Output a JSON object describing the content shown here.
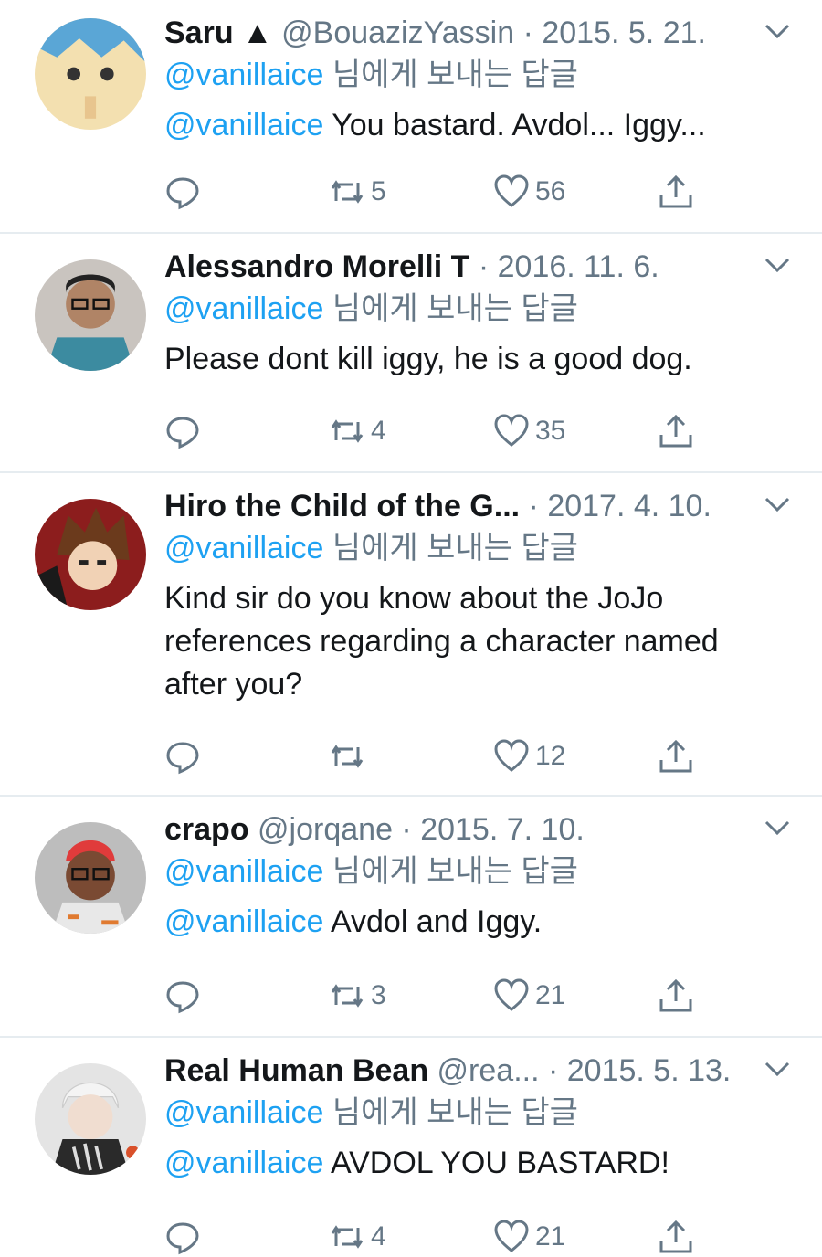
{
  "colors": {
    "accent": "#1da1f2",
    "secondary": "#657786",
    "divider": "#e6ecf0"
  },
  "tweets": [
    {
      "name": "Saru ▲",
      "handle": "@BouazizYassin",
      "date": "2015. 5. 21.",
      "reply_mention": "@vanillaice",
      "reply_suffix": " 님에게 보내는 답글",
      "text_mention": "@vanillaice",
      "text": " You bastard. Avdol... Iggy...",
      "retweets": "5",
      "likes": "56"
    },
    {
      "name": "Alessandro Morelli T",
      "handle": "",
      "date": "2016. 11. 6.",
      "reply_mention": "@vanillaice",
      "reply_suffix": " 님에게 보내는 답글",
      "text_mention": "",
      "text": "Please dont kill iggy, he is a good dog.",
      "retweets": "4",
      "likes": "35"
    },
    {
      "name": "Hiro the Child of the G...",
      "handle": "",
      "date": "2017. 4. 10.",
      "reply_mention": "@vanillaice",
      "reply_suffix": " 님에게 보내는 답글",
      "text_mention": "",
      "text": "Kind sir do you know about the JoJo references regarding a character named after you?",
      "retweets": "",
      "likes": "12"
    },
    {
      "name": "crapo",
      "handle": "@jorqane",
      "date": "2015. 7. 10.",
      "reply_mention": "@vanillaice",
      "reply_suffix": " 님에게 보내는 답글",
      "text_mention": "@vanillaice",
      "text": " Avdol and Iggy.",
      "retweets": "3",
      "likes": "21"
    },
    {
      "name": "Real Human Bean",
      "handle": "@rea...",
      "date": "2015. 5. 13.",
      "reply_mention": "@vanillaice",
      "reply_suffix": " 님에게 보내는 답글",
      "text_mention": "@vanillaice",
      "text": " AVDOL YOU BASTARD!",
      "retweets": "4",
      "likes": "21"
    }
  ],
  "icons": {
    "reply": "reply-icon",
    "retweet": "retweet-icon",
    "like": "heart-icon",
    "share": "share-icon",
    "menu": "chevron-down-icon"
  }
}
